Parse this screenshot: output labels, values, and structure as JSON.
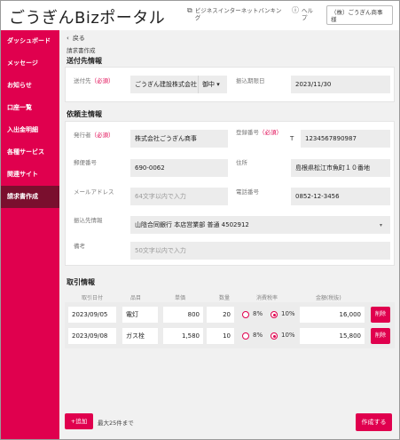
{
  "header": {
    "logo": "ごうぎんBizポータル",
    "internet_banking": "ビジネスインターネットバンキング",
    "help": "ヘルプ",
    "user": "（株）ごうぎん商事 様"
  },
  "sidebar": {
    "items": [
      {
        "label": "ダッシュボード",
        "active": false
      },
      {
        "label": "メッセージ",
        "active": false
      },
      {
        "label": "お知らせ",
        "active": false
      },
      {
        "label": "口座一覧",
        "active": false
      },
      {
        "label": "入出金明細",
        "active": false
      },
      {
        "label": "各種サービス",
        "active": false
      },
      {
        "label": "関連サイト",
        "active": false
      },
      {
        "label": "請求書作成",
        "active": true
      }
    ]
  },
  "main": {
    "back": "戻る",
    "page_title": "請求書作成",
    "required": "（必須）",
    "recipient": {
      "title": "送付先情報",
      "dest_label": "送付先",
      "dest_value": "ごうぎん建設株式会社",
      "honorific": "御中",
      "due_label": "振込期限日",
      "due_value": "2023/11/30"
    },
    "requester": {
      "title": "依頼主情報",
      "issuer_label": "発行者",
      "issuer_value": "株式会社ごうぎん商事",
      "regno_label": "登録番号",
      "regno_prefix": "T",
      "regno_value": "1234567890987",
      "postal_label": "郵便番号",
      "postal_value": "690-0062",
      "address_label": "住所",
      "address_value": "島根県松江市魚町１０番地",
      "email_label": "メールアドレス",
      "email_placeholder": "64文字以内で入力",
      "phone_label": "電話番号",
      "phone_value": "0852-12-3456",
      "account_label": "振込先情報",
      "account_value": "山陰合同銀行 本店営業部 普通 4502912",
      "note_label": "備考",
      "note_placeholder": "50文字以内で入力"
    },
    "transactions": {
      "title": "取引情報",
      "headers": [
        "取引日付",
        "品目",
        "単価",
        "数量",
        "消費税率",
        "金額(税抜)"
      ],
      "tax_8": "8%",
      "tax_10": "10%",
      "delete": "削除",
      "rows": [
        {
          "date": "2023/09/05",
          "item": "電灯",
          "price": "800",
          "qty": "20",
          "tax": "10%",
          "amount": "16,000"
        },
        {
          "date": "2023/09/08",
          "item": "ガス栓",
          "price": "1,580",
          "qty": "10",
          "tax": "10%",
          "amount": "15,800"
        }
      ],
      "add": "+追加",
      "max_note": "最大25件まで",
      "create": "作成する"
    }
  }
}
